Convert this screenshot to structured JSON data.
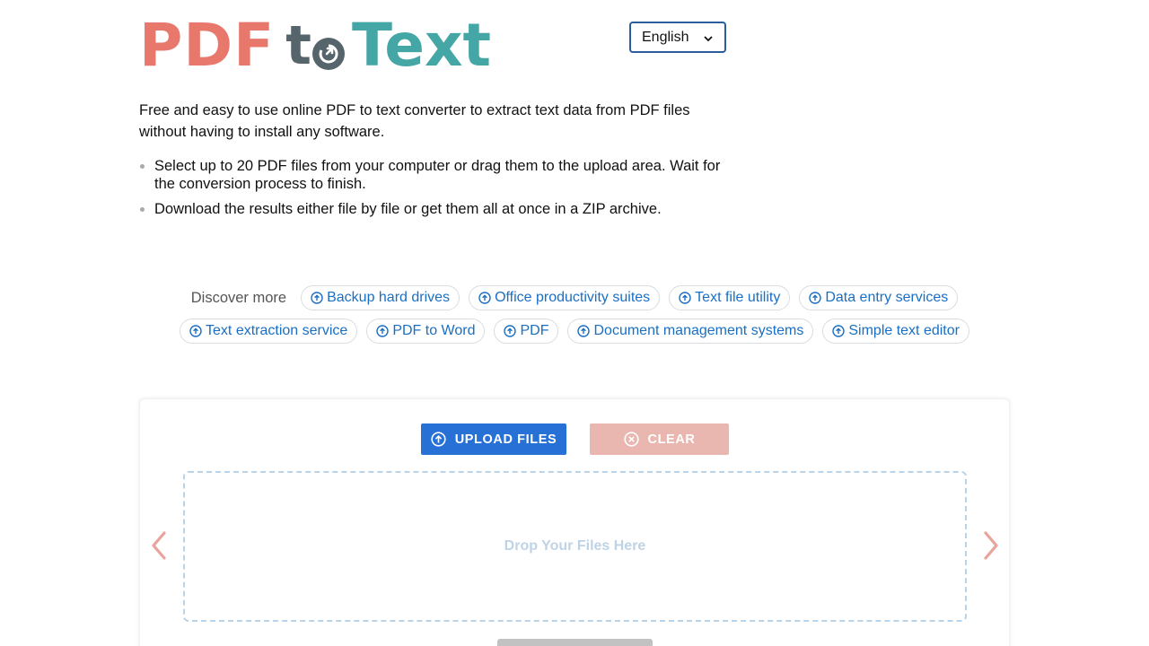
{
  "logo": {
    "part1": "PDF",
    "part2": "t",
    "part3": "Text"
  },
  "language": {
    "selected": "English"
  },
  "intro": "Free and easy to use online PDF to text converter to extract text data from PDF files without having to install any software.",
  "bullets": [
    "Select up to 20 PDF files from your computer or drag them to the upload area. Wait for the conversion process to finish.",
    "Download the results either file by file or get them all at once in a ZIP archive."
  ],
  "discover": {
    "label": "Discover more",
    "row1": [
      "Backup hard drives",
      "Office productivity suites",
      "Text file utility",
      "Data entry services"
    ],
    "row2": [
      "Text extraction service",
      "PDF to Word",
      "PDF",
      "Document management systems",
      "Simple text editor"
    ]
  },
  "uploader": {
    "upload_label": "UPLOAD FILES",
    "clear_label": "CLEAR",
    "dropzone_text": "Drop Your Files Here"
  },
  "colors": {
    "logo_pdf": "#e8786b",
    "logo_to": "#56646c",
    "logo_text": "#45a6a6",
    "primary": "#2670d6",
    "clear_disabled": "#eab6b0",
    "link": "#1a6fc4"
  }
}
